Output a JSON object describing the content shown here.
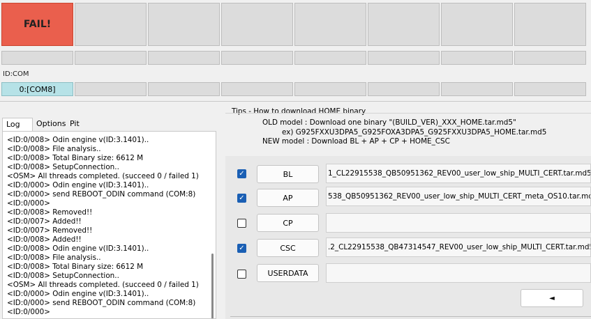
{
  "status": {
    "fail_label": "FAIL!"
  },
  "idcom": {
    "label": "ID:COM",
    "port": "0:[COM8]"
  },
  "tabs": [
    {
      "label": "Log"
    },
    {
      "label": "Options"
    },
    {
      "label": "Pit"
    }
  ],
  "log": [
    "<ID:0/008> Odin engine v(ID:3.1401)..",
    "<ID:0/008> File analysis..",
    "<ID:0/008> Total Binary size: 6612 M",
    "<ID:0/008> SetupConnection..",
    "<OSM> All threads completed. (succeed 0 / failed 1)",
    "<ID:0/000> Odin engine v(ID:3.1401)..",
    "<ID:0/000> send REBOOT_ODIN command (COM:8)",
    "<ID:0/000>",
    "<ID:0/008> Removed!!",
    "<ID:0/007> Added!!",
    "<ID:0/007> Removed!!",
    "<ID:0/008> Added!!",
    "<ID:0/008> Odin engine v(ID:3.1401)..",
    "<ID:0/008> File analysis..",
    "<ID:0/008> Total Binary size: 6612 M",
    "<ID:0/008> SetupConnection..",
    "<OSM> All threads completed. (succeed 0 / failed 1)",
    "<ID:0/000> Odin engine v(ID:3.1401)..",
    "<ID:0/000> send REBOOT_ODIN command (COM:8)",
    "<ID:0/000>"
  ],
  "tips": {
    "title": "Tips - How to download HOME binary",
    "line1": "OLD model  : Download one binary    \"(BUILD_VER)_XXX_HOME.tar.md5\"",
    "line2": "ex) G925FXXU3DPA5_G925FOXA3DPA5_G925FXXU3DPA5_HOME.tar.md5",
    "line3": "NEW model : Download BL + AP + CP + HOME_CSC"
  },
  "files": [
    {
      "label": "BL",
      "checked": true,
      "path": "1_CL22915538_QB50951362_REV00_user_low_ship_MULTI_CERT.tar.md5"
    },
    {
      "label": "AP",
      "checked": true,
      "path": "538_QB50951362_REV00_user_low_ship_MULTI_CERT_meta_OS10.tar.md5"
    },
    {
      "label": "CP",
      "checked": false,
      "path": ""
    },
    {
      "label": "CSC",
      "checked": true,
      "path": ".2_CL22915538_QB47314547_REV00_user_low_ship_MULTI_CERT.tar.md5"
    },
    {
      "label": "USERDATA",
      "checked": false,
      "path": ""
    }
  ],
  "start_button_icon": "play-left-arrow-icon",
  "start_button_glyph": "◄",
  "check_glyph": "✓",
  "colors": {
    "fail": "#ea5f4d",
    "com_active": "#b6e2e7",
    "checkbox": "#1a5fb4"
  }
}
